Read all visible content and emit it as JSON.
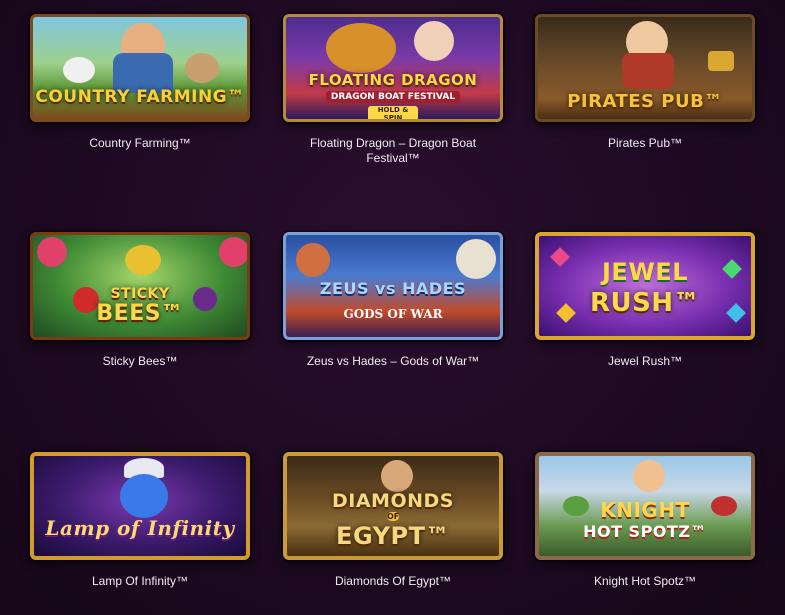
{
  "games": [
    {
      "caption": "Country Farming™",
      "thumb_title": "COUNTRY FARMING™"
    },
    {
      "caption": "Floating Dragon – Dragon Boat Festival™",
      "thumb_title": "FLOATING DRAGON",
      "thumb_sub": "DRAGON BOAT FESTIVAL",
      "thumb_badge": "HOLD & SPIN"
    },
    {
      "caption": "Pirates Pub™",
      "thumb_title": "PIRATES PUB™"
    },
    {
      "caption": "Sticky Bees™",
      "thumb_title": "STICKY",
      "thumb_title2": "BEES™"
    },
    {
      "caption": "Zeus vs Hades – Gods of War™",
      "thumb_title": "ZEUS vs HADES",
      "thumb_sub": "GODS OF WAR"
    },
    {
      "caption": "Jewel Rush™",
      "thumb_title": "JEWEL",
      "thumb_title2": "RUSH™"
    },
    {
      "caption": "Lamp Of Infinity™",
      "thumb_title": "Lamp of Infinity"
    },
    {
      "caption": "Diamonds Of Egypt™",
      "thumb_title": "DIAMONDS",
      "thumb_sub": "OF",
      "thumb_title2": "EGYPT™"
    },
    {
      "caption": "Knight Hot Spotz™",
      "thumb_title": "KNIGHT",
      "thumb_title2": "HOT SPOTZ™"
    }
  ],
  "colors": {
    "background": "#1d0a22",
    "caption_text": "#f2ecf2",
    "gold": "#f5c33a"
  }
}
